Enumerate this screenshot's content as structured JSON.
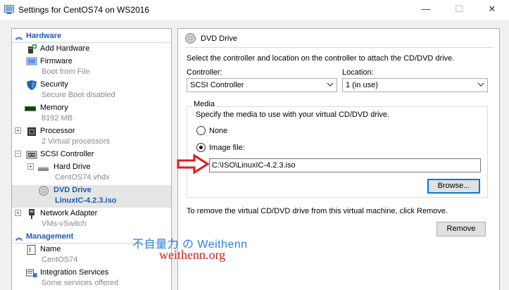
{
  "window": {
    "title": "Settings for CentOS74 on WS2016",
    "controls": {
      "minimize": "—",
      "maximize": "☐",
      "close": "✕"
    }
  },
  "sidebar": {
    "sections": [
      {
        "label": "Hardware",
        "icon": "chevron-up-icon"
      },
      {
        "label": "Management",
        "icon": "chevron-up-icon"
      }
    ],
    "hardware_items": [
      {
        "label": "Add Hardware",
        "subtitle": "",
        "icon": "add-hardware-icon",
        "expander": ""
      },
      {
        "label": "Firmware",
        "subtitle": "Boot from File",
        "icon": "firmware-icon",
        "expander": ""
      },
      {
        "label": "Security",
        "subtitle": "Secure Boot disabled",
        "icon": "shield-icon",
        "expander": ""
      },
      {
        "label": "Memory",
        "subtitle": "8192 MB",
        "icon": "memory-icon",
        "expander": ""
      },
      {
        "label": "Processor",
        "subtitle": "2 Virtual processors",
        "icon": "processor-icon",
        "expander": "+"
      },
      {
        "label": "SCSI Controller",
        "subtitle": "",
        "icon": "scsi-controller-icon",
        "expander": "−"
      },
      {
        "label": "Hard Drive",
        "subtitle": "CentOS74.vhdx",
        "icon": "hard-drive-icon",
        "expander": "+"
      },
      {
        "label": "DVD Drive",
        "subtitle": "LinuxIC-4.2.3.iso",
        "icon": "dvd-drive-icon",
        "expander": ""
      },
      {
        "label": "Network Adapter",
        "subtitle": "VMs-vSwitch",
        "icon": "network-adapter-icon",
        "expander": "+"
      }
    ],
    "management_items": [
      {
        "label": "Name",
        "subtitle": "CentOS74",
        "icon": "name-icon"
      },
      {
        "label": "Integration Services",
        "subtitle": "Some services offered",
        "icon": "integration-services-icon"
      }
    ],
    "selected": "DVD Drive"
  },
  "panel": {
    "title": "DVD Drive",
    "description": "Select the controller and location on the controller to attach the CD/DVD drive.",
    "controller_label": "Controller:",
    "controller_value": "SCSI Controller",
    "location_label": "Location:",
    "location_value": "1 (in use)",
    "media": {
      "group_label": "Media",
      "description": "Specify the media to use with your virtual CD/DVD drive.",
      "none_label": "None",
      "image_file_label": "Image file:",
      "selected_option": "Image file:",
      "image_path": "C:\\ISO\\LinuxIC-4.2.3.iso",
      "browse_label": "Browse..."
    },
    "remove_description": "To remove the virtual CD/DVD drive from this virtual machine, click Remove.",
    "remove_label": "Remove"
  },
  "watermark": {
    "line1": "不自量力 の Weithenn",
    "line2": "weithenn.org"
  },
  "colors": {
    "accent": "#1c5bb5",
    "selection_bg": "#e5e5e5",
    "arrow": "#e01b1b",
    "watermark_blue": "#2f80d8",
    "watermark_red": "#d21d1d"
  }
}
